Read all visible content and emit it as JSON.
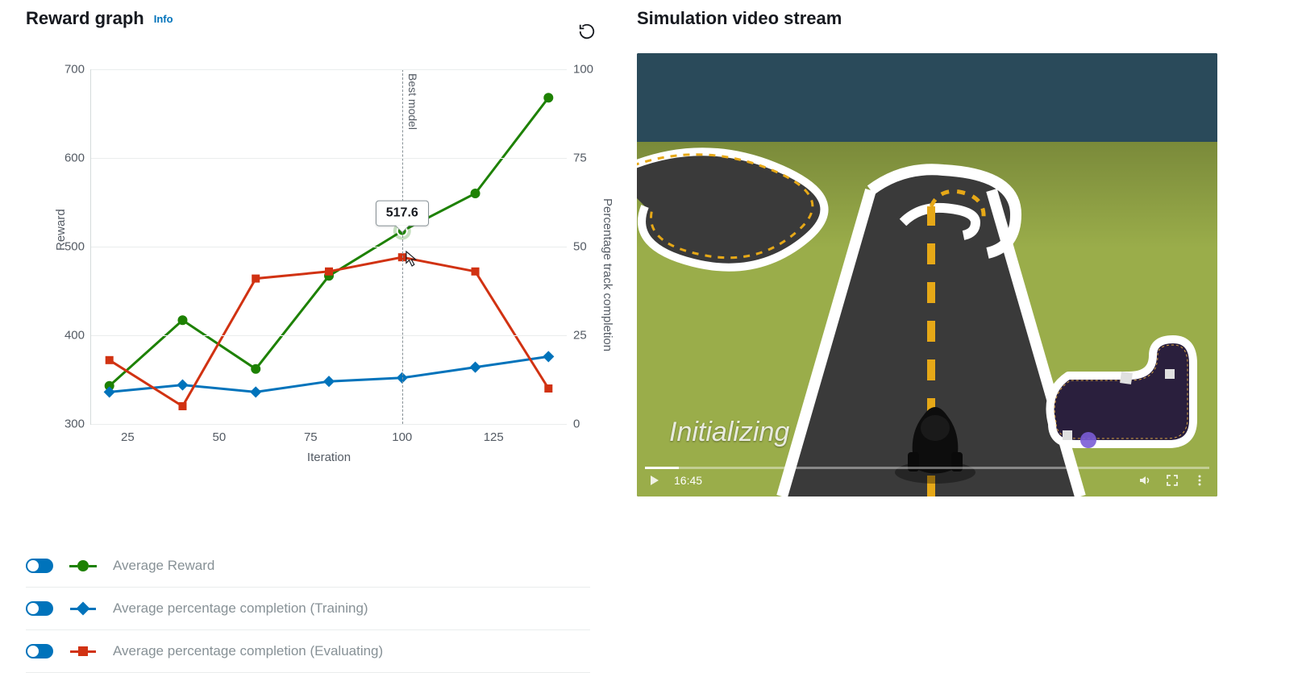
{
  "left": {
    "title": "Reward graph",
    "info": "Info",
    "colors": {
      "reward": "#1d8102",
      "training": "#0073bb",
      "evaluating": "#d13212"
    },
    "tooltip_value": "517.6",
    "best_model_label": "Best model"
  },
  "chart_data": {
    "type": "line",
    "xlabel": "Iteration",
    "ylabel_left": "Reward",
    "ylabel_right": "Percentage track completion",
    "xlim": [
      15,
      145
    ],
    "ylim_left": [
      300,
      700
    ],
    "ylim_right": [
      0,
      100
    ],
    "xticks": [
      25,
      50,
      75,
      100,
      125
    ],
    "yticks_left": [
      300,
      400,
      500,
      600,
      700
    ],
    "yticks_right": [
      0,
      25,
      50,
      75,
      100
    ],
    "x": [
      20,
      40,
      60,
      80,
      100,
      120,
      140
    ],
    "series": [
      {
        "name": "Average Reward",
        "axis": "left",
        "marker": "circle",
        "color": "#1d8102",
        "values": [
          343,
          417,
          362,
          467,
          517.6,
          560,
          668
        ]
      },
      {
        "name": "Average percentage completion (Training)",
        "axis": "right",
        "marker": "diamond",
        "color": "#0073bb",
        "values": [
          9,
          11,
          9,
          12,
          13,
          16,
          19
        ]
      },
      {
        "name": "Average percentage completion (Evaluating)",
        "axis": "right",
        "marker": "square",
        "color": "#d13212",
        "values": [
          18,
          5,
          41,
          43,
          47,
          43,
          10
        ]
      }
    ],
    "best_model_x": 100,
    "tooltip": {
      "x": 100,
      "y_left": 517.6
    }
  },
  "legend": [
    {
      "label": "Average Reward",
      "color": "#1d8102",
      "marker": "circle"
    },
    {
      "label": "Average percentage completion (Training)",
      "color": "#0073bb",
      "marker": "diamond"
    },
    {
      "label": "Average percentage completion (Evaluating)",
      "color": "#d13212",
      "marker": "square"
    }
  ],
  "right": {
    "title": "Simulation video stream",
    "overlay": "Initializing",
    "time": "16:45"
  }
}
